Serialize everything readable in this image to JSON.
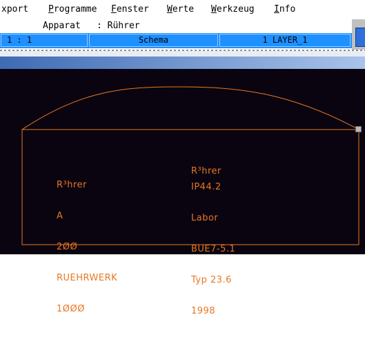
{
  "menubar": {
    "items": [
      {
        "label": "xport",
        "mnemonic": ""
      },
      {
        "label": "rogramme",
        "mnemonic": "P"
      },
      {
        "label": "enster",
        "mnemonic": "F"
      },
      {
        "label": "erte",
        "mnemonic": "W"
      },
      {
        "label": "erkzeug",
        "mnemonic": "W"
      },
      {
        "label": "nfo",
        "mnemonic": "I"
      }
    ]
  },
  "infobar": {
    "label": "Apparat",
    "value": ": Rührer"
  },
  "statusbar": {
    "scale": "1 : 1",
    "view": "Schema",
    "layer": "1 LAYER_1"
  },
  "drawing": {
    "left_block": [
      "R³hrer",
      "A",
      "2ØØ",
      "RUEHRWERK",
      "1ØØØ"
    ],
    "right_block": [
      "IP44.2",
      "Labor",
      "BUE7-5.1",
      "Typ 23.6",
      "1998"
    ],
    "overlap_text": "R³hrer",
    "line_color": "#e87722",
    "background_color": "#0a0410"
  }
}
